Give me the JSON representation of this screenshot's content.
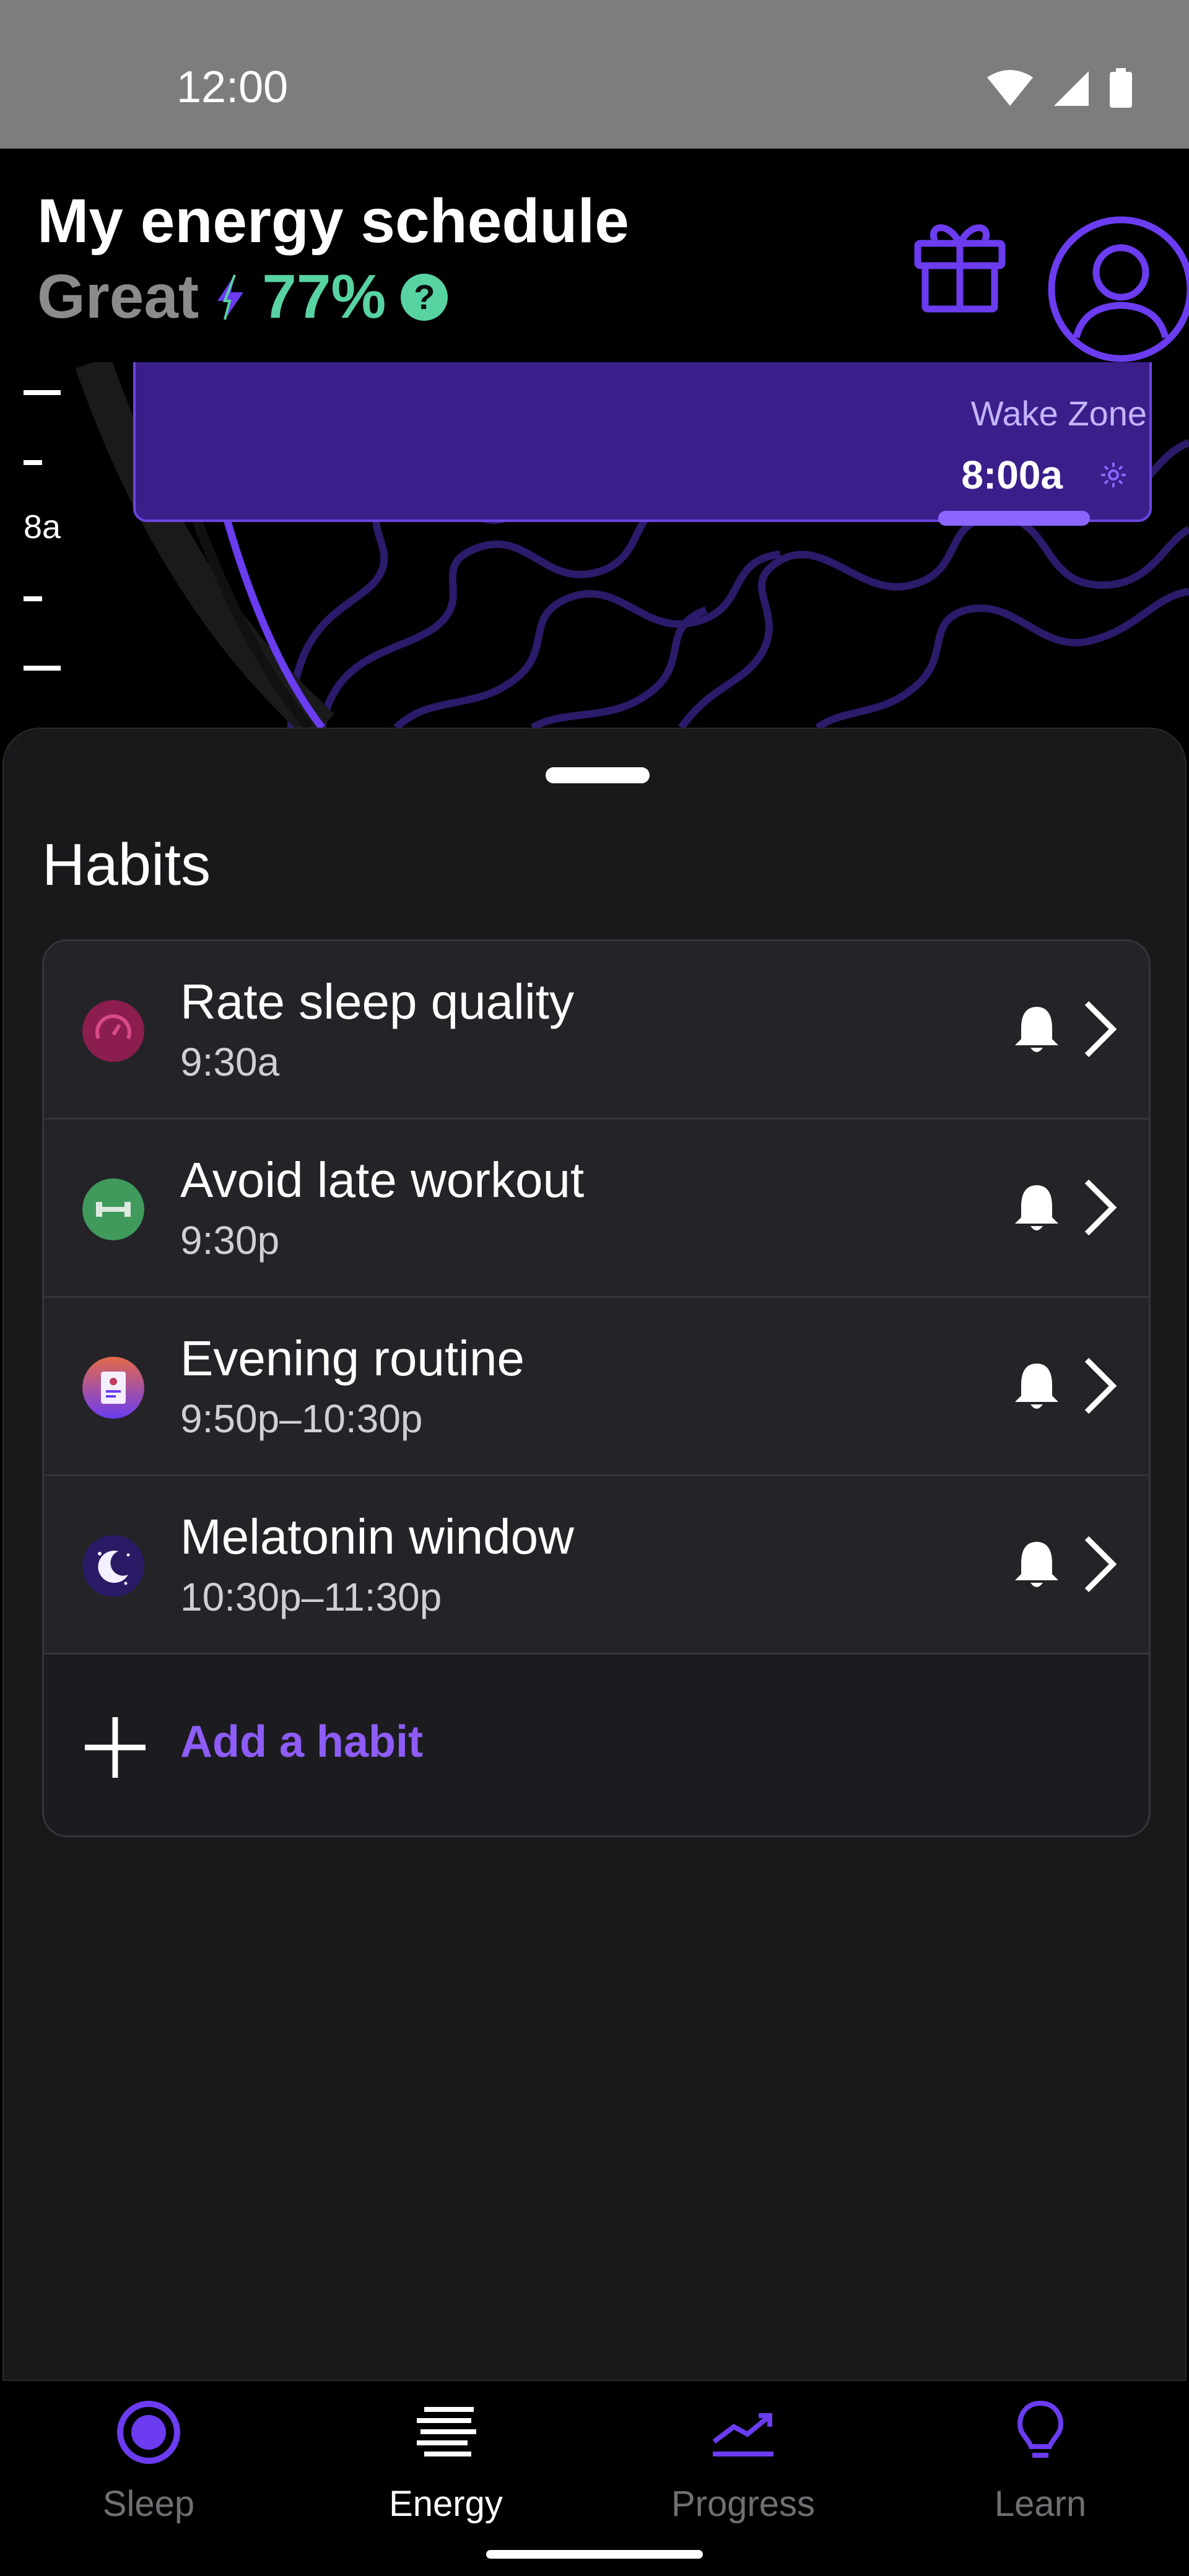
{
  "status_bar": {
    "time": "12:00"
  },
  "header": {
    "title": "My energy schedule",
    "score_label": "Great",
    "score_value": "77%",
    "help_symbol": "?",
    "colors": {
      "accent": "#6b3cf0",
      "score": "#58d3a2",
      "label": "#8b8b8b"
    }
  },
  "timeline": {
    "hour_label": "8a",
    "zone": {
      "label": "Wake Zone",
      "time": "8:00a"
    }
  },
  "sheet": {
    "title": "Habits",
    "habits": [
      {
        "name": "Rate sleep quality",
        "time": "9:30a",
        "icon": "gauge-icon"
      },
      {
        "name": "Avoid late workout",
        "time": "9:30p",
        "icon": "dumbbell-icon"
      },
      {
        "name": "Evening routine",
        "time": "9:50p–10:30p",
        "icon": "routine-icon"
      },
      {
        "name": "Melatonin window",
        "time": "10:30p–11:30p",
        "icon": "moon-icon"
      }
    ],
    "add_label": "Add a habit"
  },
  "nav": {
    "items": [
      {
        "label": "Sleep",
        "icon": "sleep-ring-icon",
        "active": false
      },
      {
        "label": "Energy",
        "icon": "energy-lines-icon",
        "active": true
      },
      {
        "label": "Progress",
        "icon": "progress-chart-icon",
        "active": false
      },
      {
        "label": "Learn",
        "icon": "lightbulb-icon",
        "active": false
      }
    ]
  }
}
